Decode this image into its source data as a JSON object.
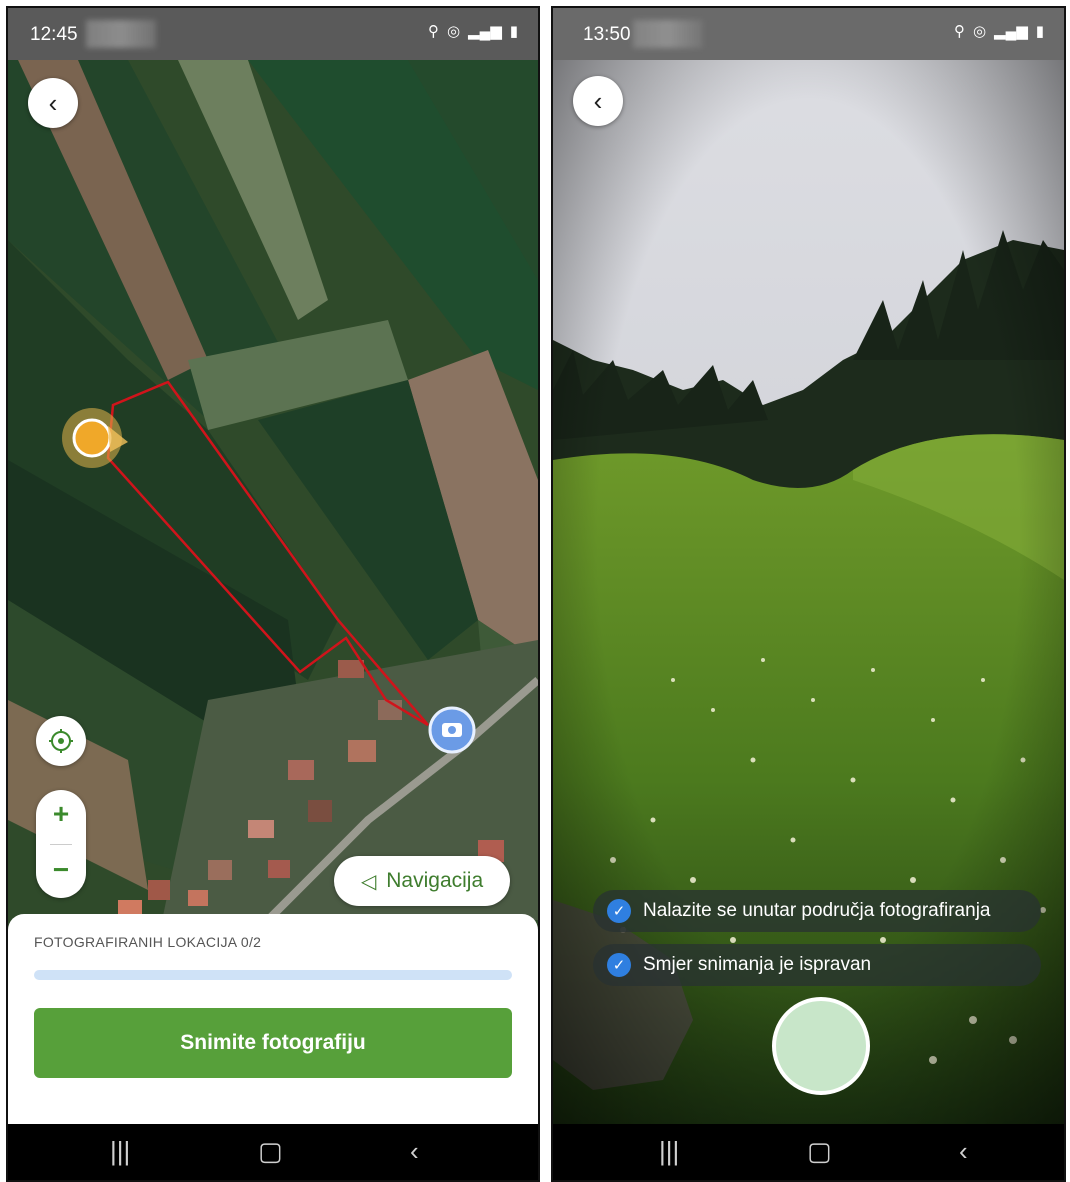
{
  "left_screen": {
    "status": {
      "time": "12:45"
    },
    "navigation_button": {
      "label": "Navigacija",
      "icon": "navigation-arrow-icon"
    },
    "zoom": {
      "plus": "+",
      "minus": "−"
    },
    "panel": {
      "counter": "FOTOGRAFIRANIH LOKACIJA 0/2",
      "progress": 0,
      "button": "Snimite fotografiju"
    },
    "colors": {
      "primary_green": "#57a03a",
      "progress_track": "#cfe2f7",
      "parcel_outline": "#d0141b",
      "marker_blue": "#6b9be6"
    }
  },
  "right_screen": {
    "status": {
      "time": "13:50"
    },
    "checks": [
      {
        "label": "Nalazite se unutar područja fotografiranja",
        "checked": true
      },
      {
        "label": "Smjer snimanja je ispravan",
        "checked": true
      }
    ],
    "colors": {
      "shutter": "#c8e6c9",
      "check_blue": "#2f7fe0"
    }
  }
}
